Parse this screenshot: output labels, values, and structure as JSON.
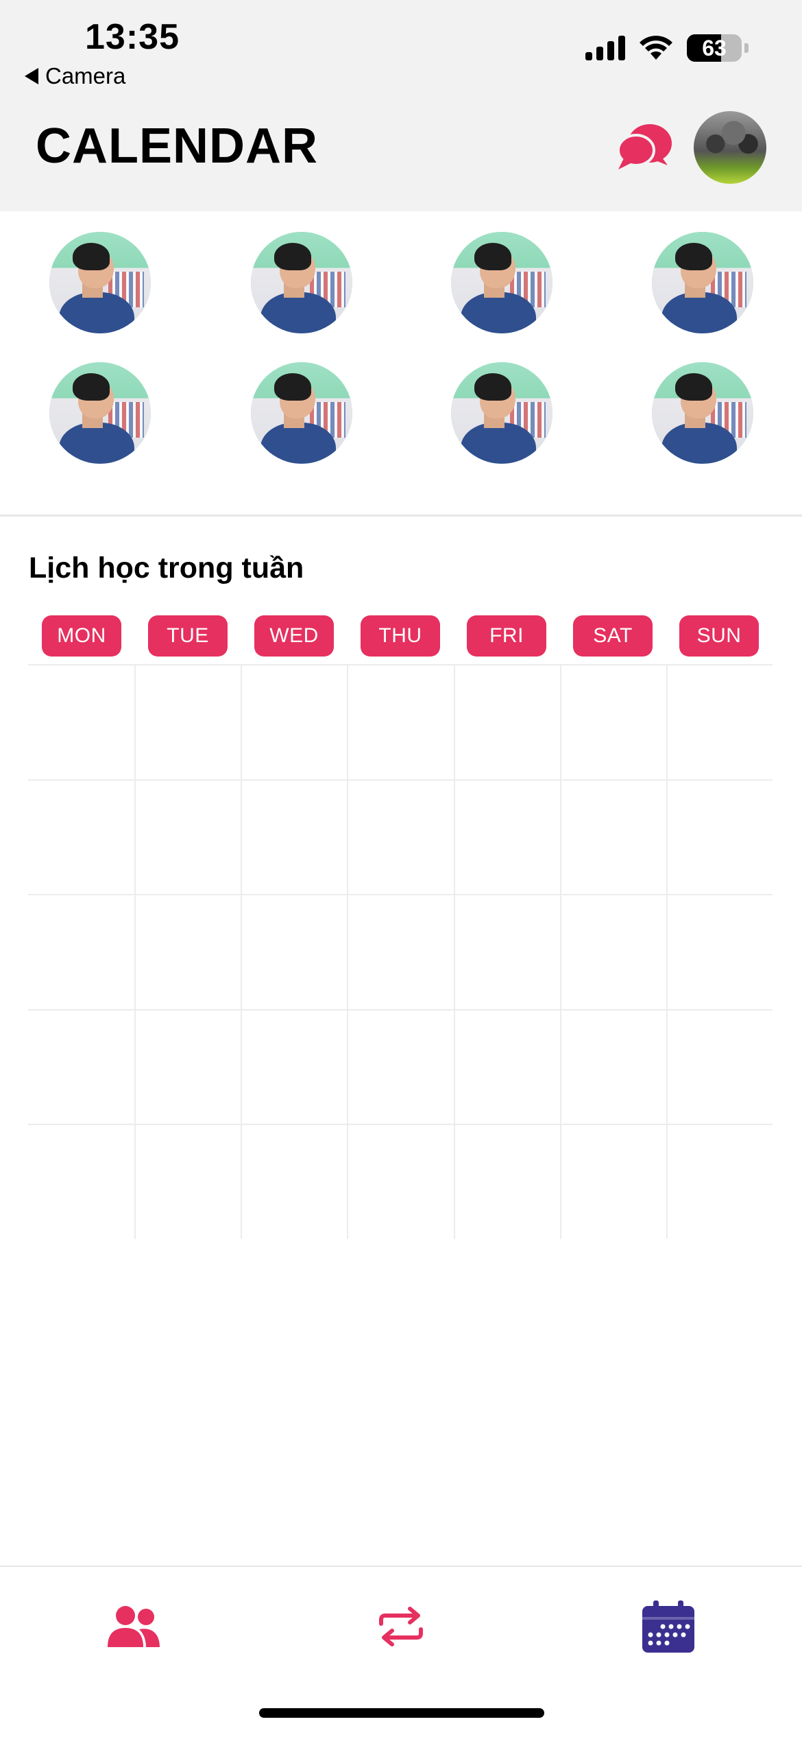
{
  "status_bar": {
    "time": "13:35",
    "back_app": "Camera",
    "battery": "63",
    "battery_level": 0.63
  },
  "header": {
    "title": "CALENDAR",
    "chat_icon": "chat-bubbles-icon",
    "avatar": "profile-avatar"
  },
  "friends": {
    "count": 8
  },
  "schedule": {
    "title": "Lịch học trong tuần",
    "days": [
      "MON",
      "TUE",
      "WED",
      "THU",
      "FRI",
      "SAT",
      "SUN"
    ],
    "rows": 5
  },
  "bottom_nav": {
    "items": [
      {
        "icon": "users-icon"
      },
      {
        "icon": "repeat-icon"
      },
      {
        "icon": "calendar-icon"
      }
    ]
  },
  "colors": {
    "accent": "#e6305f",
    "nav_active": "#3b2f8f",
    "header_bg": "#f2f2f2"
  }
}
